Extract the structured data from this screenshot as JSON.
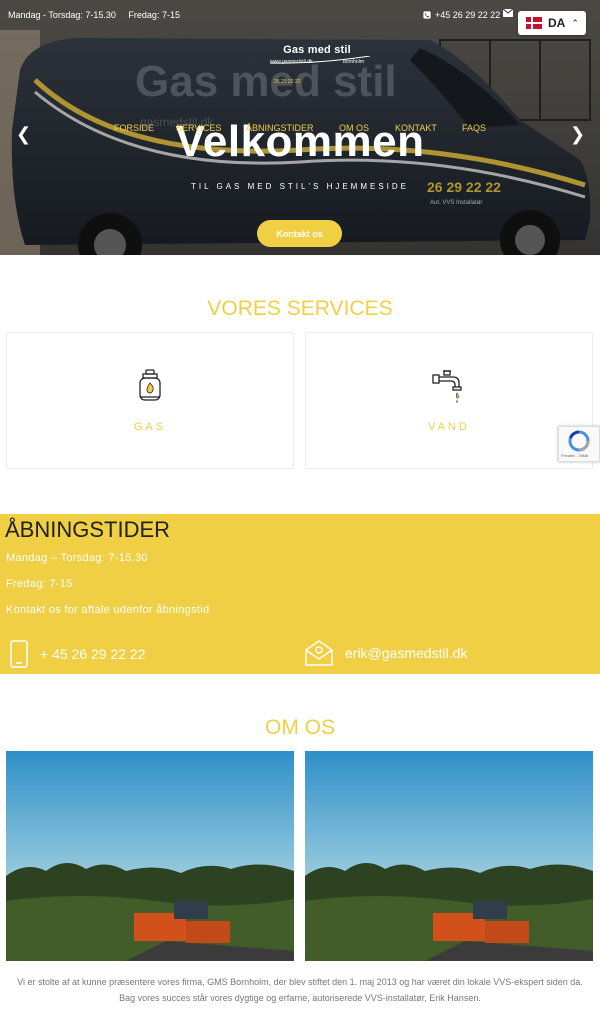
{
  "topbar": {
    "hours_weekdays": "Mandag - Torsdag: 7-15.30",
    "hours_friday": "Fredag: 7-15",
    "phone": "+45 26 29 22 22"
  },
  "language": {
    "code": "DA"
  },
  "logo": {
    "name": "Gas med stil",
    "site": "www.gasmedstil.dk",
    "place": "Bornholm",
    "phone": "26 29 22 22"
  },
  "nav": {
    "items": [
      {
        "label": "FORSIDE"
      },
      {
        "label": "SERVICES"
      },
      {
        "label": "ÅBNINGSTIDER"
      },
      {
        "label": "OM OS"
      },
      {
        "label": "KONTAKT"
      },
      {
        "label": "FAQS"
      }
    ]
  },
  "hero": {
    "title": "Velkommen",
    "subtitle": "TIL GAS MED STIL'S HJEMMESIDE",
    "button": "Kontakt os",
    "van_brand": "Gas med stil",
    "van_phone": "26 29 22 22",
    "van_tagline": "Aut. VVS Installatør",
    "van_site": "gasmedstil.dk"
  },
  "services": {
    "title": "VORES SERVICES",
    "items": [
      {
        "label": "GAS",
        "icon": "gas-cylinder-icon"
      },
      {
        "label": "VAND",
        "icon": "water-tap-icon"
      }
    ]
  },
  "recaptcha": {
    "text": "Privatliv - Vilkår"
  },
  "hours": {
    "title": "ÅBNINGSTIDER",
    "weekdays": "Mandag – Torsdag: 7-15.30",
    "friday": "Fredag: 7-15",
    "note": "Kontakt os for aftale udenfor åbningstid",
    "phone": "+ 45 26 29 22 22",
    "email": "erik@gasmedstil.dk"
  },
  "about": {
    "title": "OM OS",
    "text": "Vi er stolte af at kunne præsentere vores firma, GMS Bornholm, der blev stiftet den 1. maj 2013 og har været din lokale VVS-ekspert siden da. Bag vores succes står vores dygtige og erfarne, autoriserede VVS-installatør, Erik Hansen."
  },
  "colors": {
    "accent": "#f1cf44",
    "hours_bg": "#f0cf45",
    "text_muted": "#777777"
  }
}
